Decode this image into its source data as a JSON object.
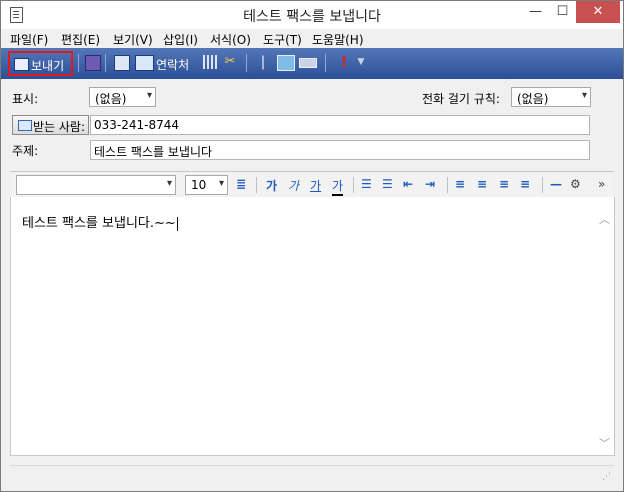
{
  "window": {
    "title": "테스트 팩스를 보냅니다",
    "min_glyph": "—",
    "max_glyph": "☐",
    "close_glyph": "✕"
  },
  "menu": [
    "파일(F)",
    "편집(E)",
    "보기(V)",
    "삽입(I)",
    "서식(O)",
    "도구(T)",
    "도움말(H)"
  ],
  "toolbar": {
    "send_label": "보내기",
    "contacts_label": "연락처",
    "highlight_color": "#e0191c",
    "bar_color": "#2b4f97"
  },
  "fields": {
    "display_label": "표시:",
    "display_value": "(없음)",
    "dial_rule_label": "전화 걸기 규칙:",
    "dial_rule_value": "(없음)",
    "to_button_label": "받는 사람:",
    "to_value": "033-241-8744",
    "subject_label": "주제:",
    "subject_value": "테스트 팩스를 보냅니다"
  },
  "format": {
    "font_value": "",
    "size_value": "10",
    "bold_glyph": "가",
    "italic_glyph": "가",
    "underline_glyph": "가",
    "color_glyph": "가",
    "overflow_glyph": "»"
  },
  "body": {
    "text": "테스트 팩스를 보냅니다.~~"
  }
}
